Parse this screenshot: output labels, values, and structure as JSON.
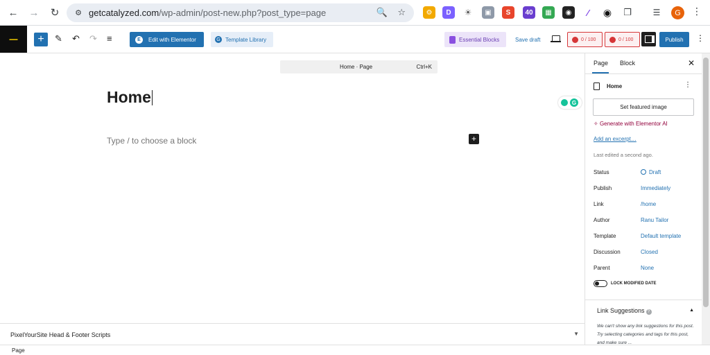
{
  "browser": {
    "url_host": "getcatalyzed.com",
    "url_path": "/wp-admin/post-new.php?post_type=page",
    "avatar_letter": "G"
  },
  "header": {
    "elementor_label": "Edit with Elementor",
    "template_label": "Template Library",
    "essential_label": "Essential Blocks",
    "save_draft_label": "Save draft",
    "score_1": "0 / 100",
    "score_2": "0 / 100",
    "publish_label": "Publish"
  },
  "canvas": {
    "command_title": "Home · Page",
    "command_shortcut": "Ctrl+K",
    "post_title": "Home",
    "placeholder": "Type / to choose a block",
    "add_block": "+"
  },
  "metabox": {
    "label": "PixelYourSite Head & Footer Scripts"
  },
  "footer": {
    "breadcrumb": "Page"
  },
  "sidebar": {
    "tab_page": "Page",
    "tab_block": "Block",
    "doc_title": "Home",
    "featured_image": "Set featured image",
    "generate_ai": "Generate with Elementor AI",
    "add_excerpt": "Add an excerpt…",
    "last_edited": "Last edited a second ago.",
    "rows": [
      {
        "key": "Status",
        "value": "Draft"
      },
      {
        "key": "Publish",
        "value": "Immediately"
      },
      {
        "key": "Link",
        "value": "/home"
      },
      {
        "key": "Author",
        "value": "Ranu Tailor"
      },
      {
        "key": "Template",
        "value": "Default template"
      },
      {
        "key": "Discussion",
        "value": "Closed"
      },
      {
        "key": "Parent",
        "value": "None"
      }
    ],
    "lock_label": "LOCK MODIFIED DATE",
    "link_suggestions_title": "Link Suggestions",
    "link_suggestions_body": "We can't show any link suggestions for this post. Try selecting categories and tags for this post, and make sure ..."
  },
  "colors": {
    "accent": "#2271b1",
    "elementor_ai": "#92003b",
    "score_red": "#d63638"
  }
}
